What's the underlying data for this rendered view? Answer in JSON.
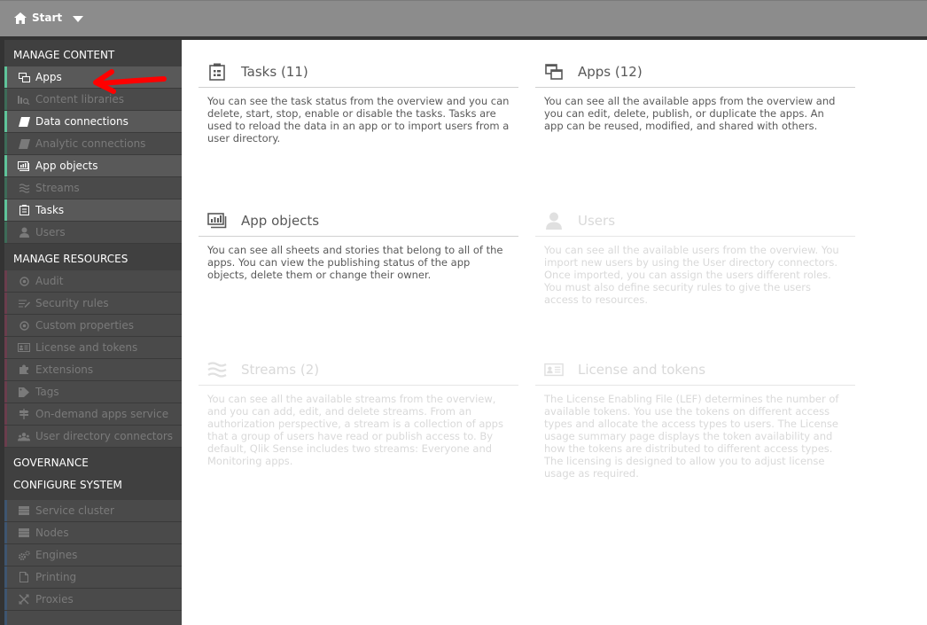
{
  "topbar": {
    "start_label": "Start",
    "home_icon": "home-icon",
    "dropdown_icon": "caret-down-icon"
  },
  "sidebar": {
    "sections": [
      {
        "title": "MANAGE CONTENT",
        "items": [
          {
            "label": "Apps",
            "icon": "apps-icon",
            "enabled": true
          },
          {
            "label": "Content libraries",
            "icon": "content-libraries-icon",
            "enabled": false
          },
          {
            "label": "Data connections",
            "icon": "data-connections-icon",
            "enabled": true
          },
          {
            "label": "Analytic connections",
            "icon": "analytic-connections-icon",
            "enabled": false
          },
          {
            "label": "App objects",
            "icon": "app-objects-icon",
            "enabled": true
          },
          {
            "label": "Streams",
            "icon": "streams-icon",
            "enabled": false
          },
          {
            "label": "Tasks",
            "icon": "tasks-icon",
            "enabled": true
          },
          {
            "label": "Users",
            "icon": "user-icon",
            "enabled": false
          }
        ]
      },
      {
        "title": "MANAGE RESOURCES",
        "items": [
          {
            "label": "Audit",
            "icon": "shield-icon",
            "enabled": false
          },
          {
            "label": "Security rules",
            "icon": "security-rules-icon",
            "enabled": false
          },
          {
            "label": "Custom properties",
            "icon": "shield-icon",
            "enabled": false
          },
          {
            "label": "License and tokens",
            "icon": "license-icon",
            "enabled": false
          },
          {
            "label": "Extensions",
            "icon": "puzzle-icon",
            "enabled": false
          },
          {
            "label": "Tags",
            "icon": "tag-icon",
            "enabled": false
          },
          {
            "label": "On-demand apps service",
            "icon": "signpost-icon",
            "enabled": false
          },
          {
            "label": "User directory connectors",
            "icon": "users-group-icon",
            "enabled": false
          }
        ]
      },
      {
        "title": "GOVERNANCE",
        "items": []
      },
      {
        "title": "CONFIGURE SYSTEM",
        "items": [
          {
            "label": "Service cluster",
            "icon": "server-icon",
            "enabled": false
          },
          {
            "label": "Nodes",
            "icon": "server-icon",
            "enabled": false
          },
          {
            "label": "Engines",
            "icon": "gears-icon",
            "enabled": false
          },
          {
            "label": "Printing",
            "icon": "document-icon",
            "enabled": false
          },
          {
            "label": "Proxies",
            "icon": "proxy-icon",
            "enabled": false
          }
        ]
      }
    ]
  },
  "cards": [
    {
      "title": "Tasks (11)",
      "icon": "tasks-icon",
      "enabled": true,
      "description": "You can see the task status from the overview and you can delete, start, stop, enable or disable the tasks. Tasks are used to reload the data in an app or to import users from a user directory."
    },
    {
      "title": "Apps (12)",
      "icon": "apps-icon",
      "enabled": true,
      "description": "You can see all the available apps from the overview and you can edit, delete, publish, or duplicate the apps. An app can be reused, modified, and shared with others."
    },
    {
      "title": "App objects",
      "icon": "app-objects-icon",
      "enabled": true,
      "description": "You can see all sheets and stories that belong to all of the apps. You can view the publishing status of the app objects, delete them or change their owner."
    },
    {
      "title": "Users",
      "icon": "user-icon",
      "enabled": false,
      "description": "You can see all the available users from the overview. You import new users by using the User directory connectors. Once imported, you can assign the users different roles. You must also define security rules to give the users access to resources."
    },
    {
      "title": "Streams (2)",
      "icon": "streams-icon",
      "enabled": false,
      "description": "You can see all the available streams from the overview, and you can add, edit, and delete streams. From an authorization perspective, a stream is a collection of apps that a group of users have read or publish access to. By default, Qlik Sense includes two streams: Everyone and Monitoring apps."
    },
    {
      "title": "License and tokens",
      "icon": "license-icon",
      "enabled": false,
      "description": "The License Enabling File (LEF) determines the number of available tokens. You use the tokens on different access types and allocate the access types to users. The License usage summary page displays the token availability and how the tokens are distributed to different access types. The licensing is designed to allow you to adjust license usage as required."
    }
  ],
  "colors": {
    "topbar": "#8c8c8c",
    "sidebar": "#404040",
    "content_accent": "#5fc49a",
    "resources_accent": "#6a3d4d",
    "system_accent": "#3e5570",
    "annotation_arrow": "#ff0000"
  }
}
